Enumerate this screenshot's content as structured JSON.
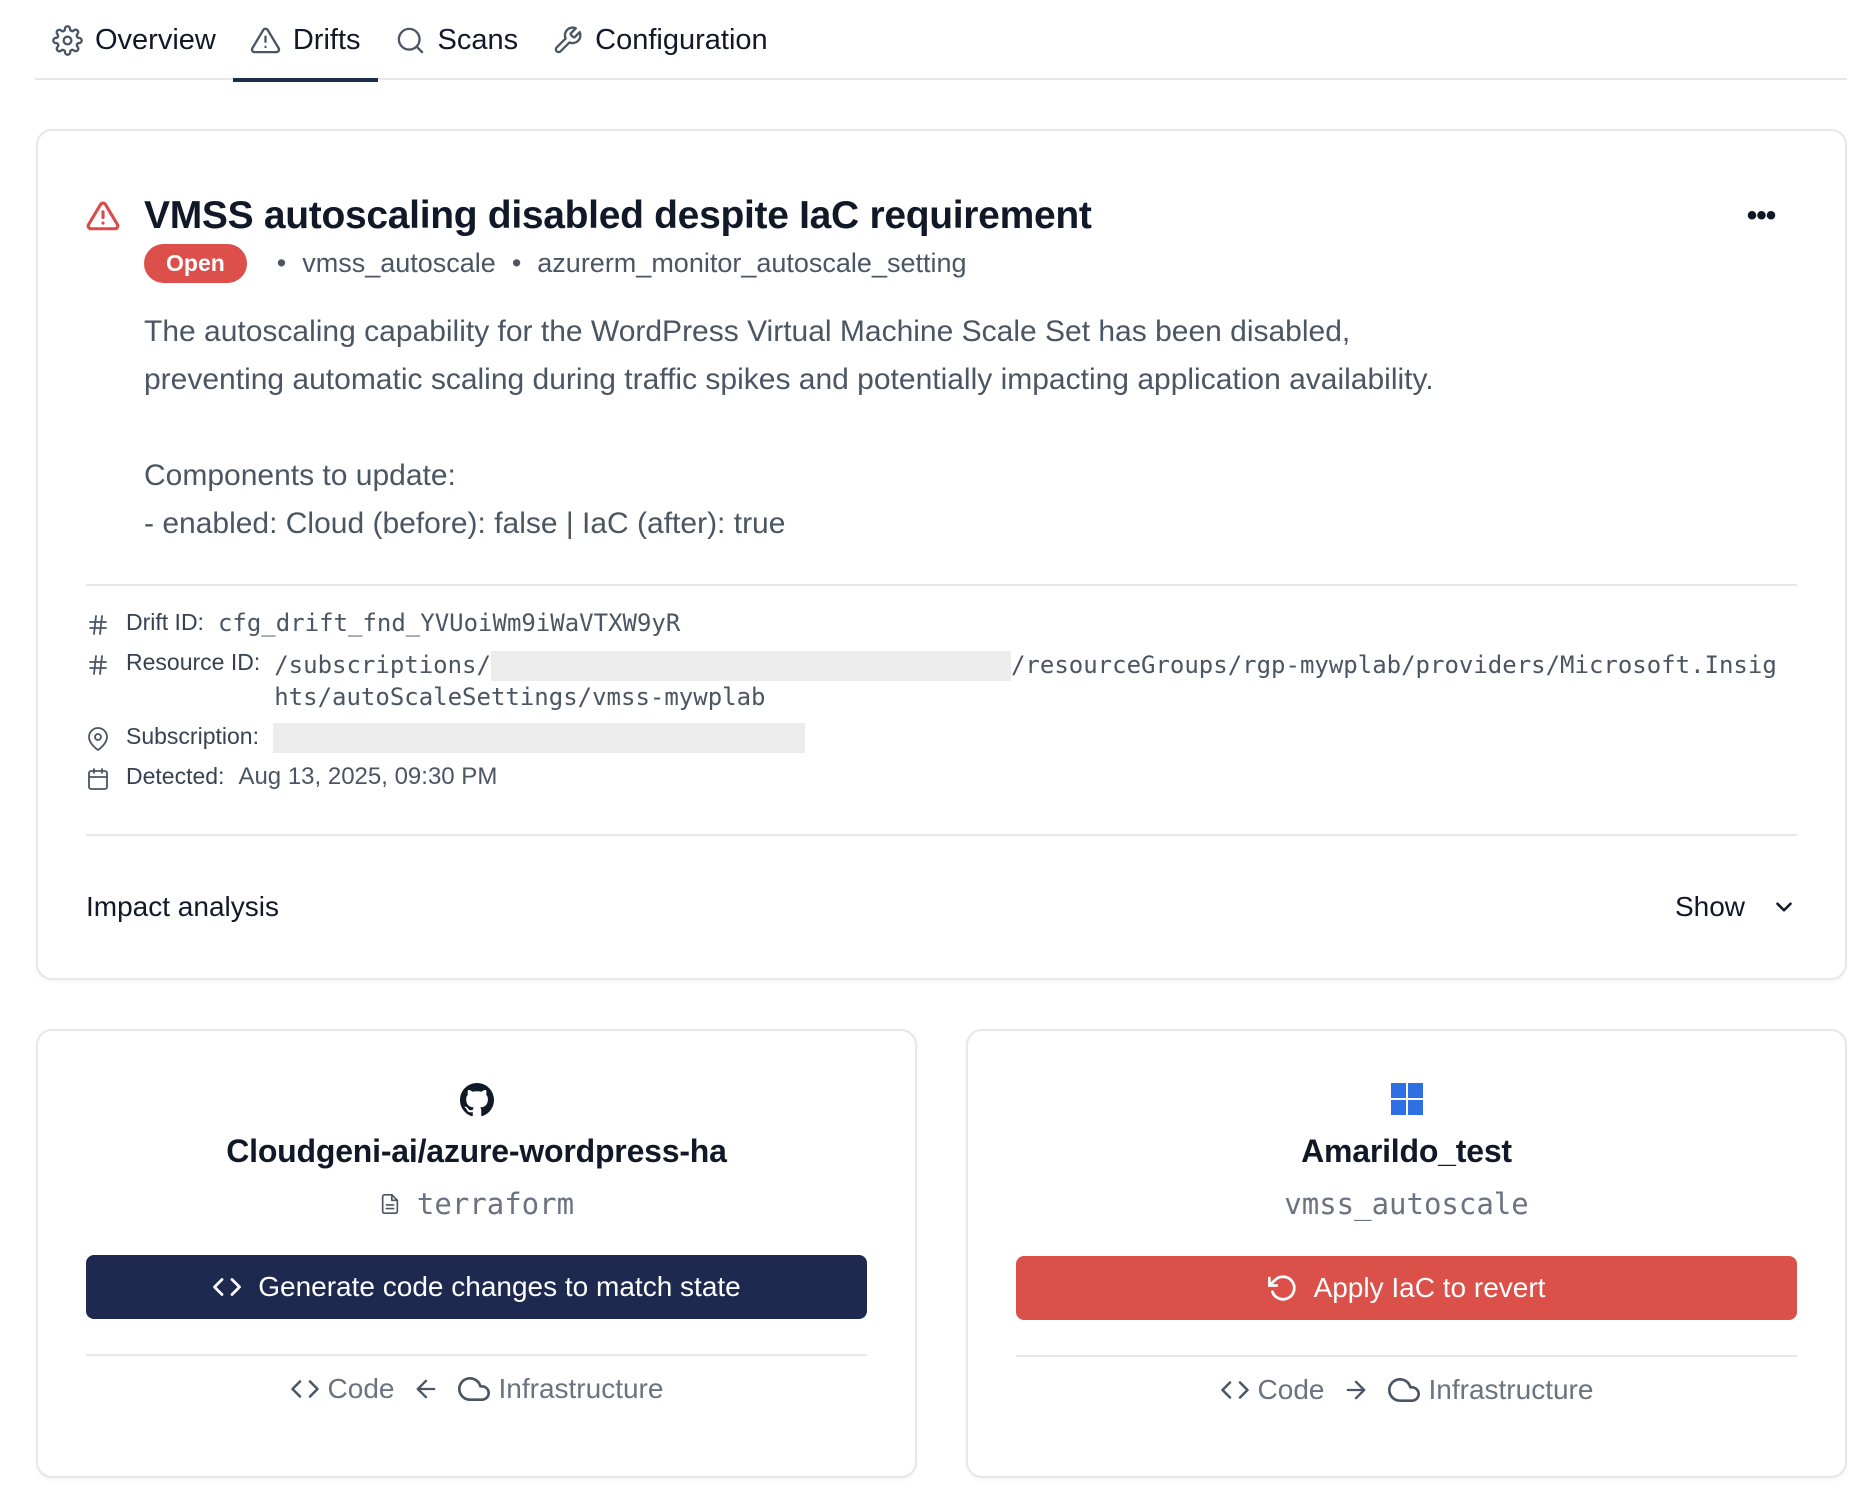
{
  "tabs": [
    {
      "label": "Overview",
      "icon": "gear-icon"
    },
    {
      "label": "Drifts",
      "icon": "warning-triangle-icon",
      "active": true
    },
    {
      "label": "Scans",
      "icon": "search-icon"
    },
    {
      "label": "Configuration",
      "icon": "wrench-icon"
    }
  ],
  "drift": {
    "title": "VMSS autoscaling disabled despite IaC requirement",
    "status": "Open",
    "resource_name": "vmss_autoscale",
    "resource_type": "azurerm_monitor_autoscale_setting",
    "description_line1": "The autoscaling capability for the WordPress Virtual Machine Scale Set has been disabled,",
    "description_line2": "preventing automatic scaling during traffic spikes and potentially impacting application availability.",
    "components_heading": "Components to update:",
    "components_item": "- enabled: Cloud (before): false | IaC (after): true",
    "details": {
      "drift_id_label": "Drift ID:",
      "drift_id": "cfg_drift_fnd_YVUoiWm9iWaVTXW9yR",
      "resource_id_label": "Resource ID:",
      "resource_id_prefix": "/subscriptions/",
      "resource_id_suffix": "/resourceGroups/rgp-mywplab/providers/Microsoft.Insig",
      "resource_id_line2": "hts/autoScaleSettings/vmss-mywplab",
      "subscription_label": "Subscription:",
      "detected_label": "Detected:",
      "detected": "Aug 13, 2025, 09:30 PM"
    },
    "impact_label": "Impact analysis",
    "show_label": "Show"
  },
  "repo_card": {
    "icon": "github-icon",
    "name": "Cloudgeni-ai/azure-wordpress-ha",
    "sub": "terraform",
    "button": "Generate code changes to match state",
    "flow_from": "Code",
    "flow_to": "Infrastructure"
  },
  "cloud_card": {
    "icon": "azure-windows-icon",
    "name": "Amarildo_test",
    "sub": "vmss_autoscale",
    "button": "Apply IaC to revert",
    "flow_from": "Code",
    "flow_to": "Infrastructure"
  },
  "colors": {
    "navy": "#1e2950",
    "danger": "#dc504a",
    "azure_blue": "#2f6fe4"
  }
}
